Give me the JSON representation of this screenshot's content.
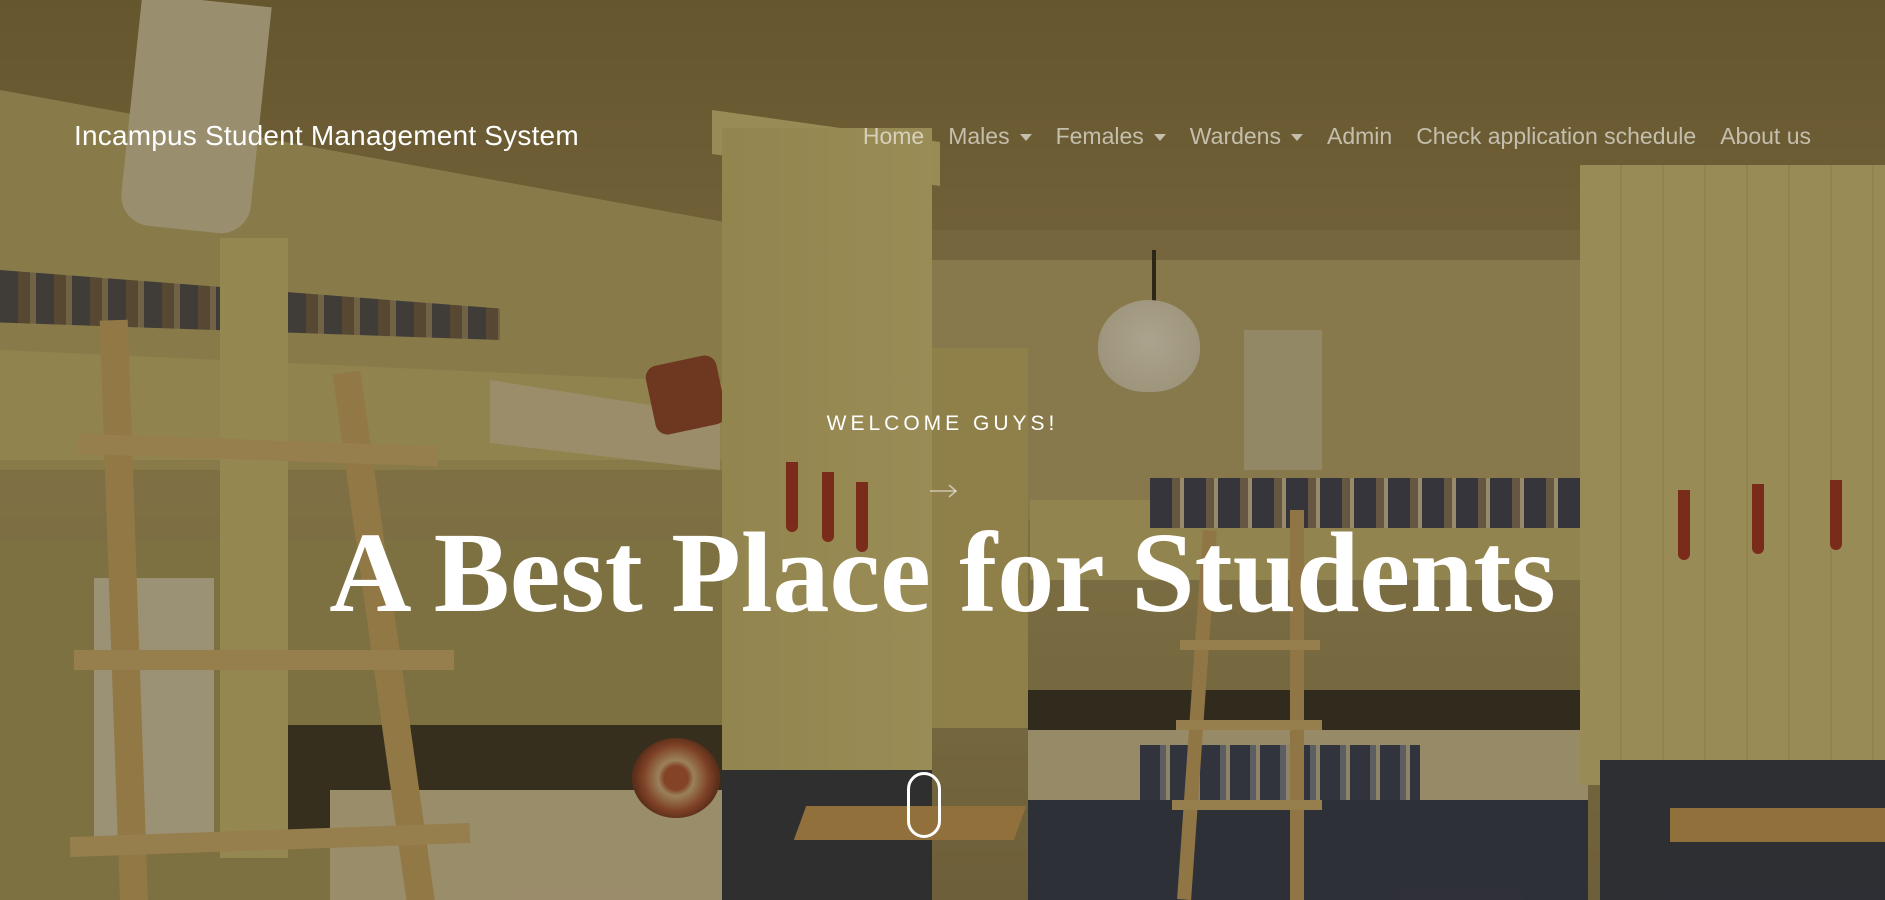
{
  "navbar": {
    "brand": "Incampus Student Management System",
    "items": [
      {
        "label": "Home",
        "dropdown": false
      },
      {
        "label": "Males",
        "dropdown": true
      },
      {
        "label": "Females",
        "dropdown": true
      },
      {
        "label": "Wardens",
        "dropdown": true
      },
      {
        "label": "Admin",
        "dropdown": false
      },
      {
        "label": "Check application schedule",
        "dropdown": false
      },
      {
        "label": "About us",
        "dropdown": false
      }
    ]
  },
  "hero": {
    "subtitle": "WELCOME GUYS!",
    "headline": "A Best Place for Students",
    "background_image": "dormitory-bunk-room",
    "arrow_icon": "long-arrow-right-icon",
    "scroll_icon": "mouse-scroll-icon"
  },
  "colors": {
    "text": "#ffffff",
    "nav_text": "rgba(255,255,255,0.6)",
    "overlay": "rgba(70,55,20,0.42)"
  }
}
